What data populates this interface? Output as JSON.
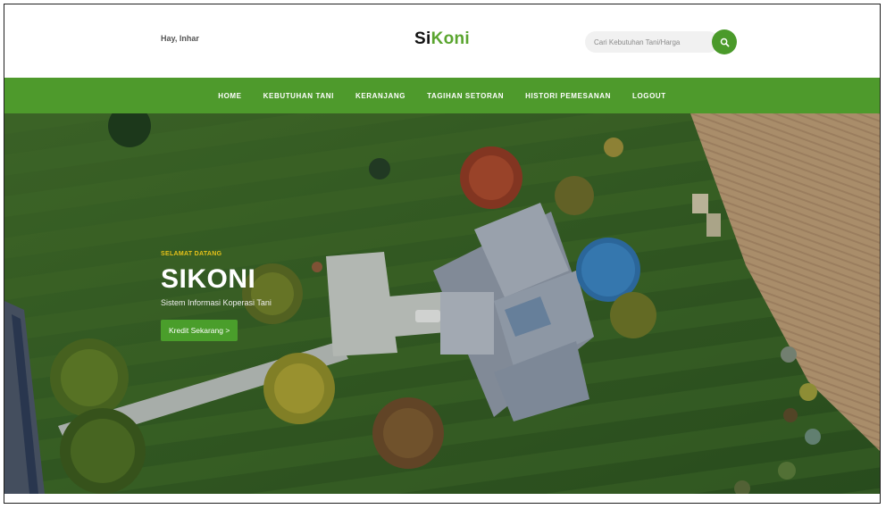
{
  "header": {
    "greeting": "Hay, Inhar",
    "logo": {
      "part1": "Si",
      "part2": "Koni"
    },
    "search": {
      "placeholder": "Cari Kebutuhan Tani/Harga",
      "icon": "search-icon"
    }
  },
  "nav": {
    "items": [
      {
        "label": "HOME"
      },
      {
        "label": "KEBUTUHAN TANI"
      },
      {
        "label": "KERANJANG"
      },
      {
        "label": "TAGIHAN SETORAN"
      },
      {
        "label": "HISTORI PEMESANAN"
      },
      {
        "label": "LOGOUT"
      }
    ]
  },
  "hero": {
    "kicker": "SELAMAT DATANG",
    "title": "SIKONI",
    "subtitle": "Sistem Informasi Koperasi Tani",
    "cta": "Kredit Sekarang >"
  },
  "colors": {
    "brand_green": "#4e9a2c",
    "accent_yellow": "#e6c21a",
    "text_dark": "#111111"
  }
}
